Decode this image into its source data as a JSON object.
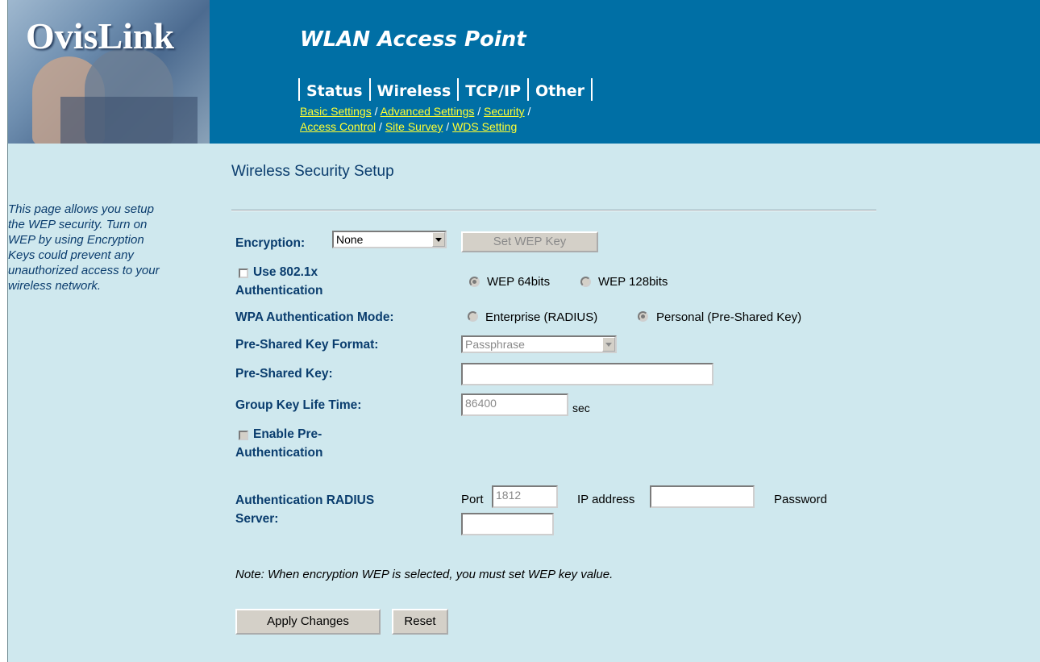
{
  "header": {
    "logo": "OvisLink",
    "title": "WLAN Access Point",
    "tabs": [
      "Status",
      "Wireless",
      "TCP/IP",
      "Other"
    ],
    "subnav_line1": [
      "Basic Settings",
      "Advanced Settings",
      "Security"
    ],
    "subnav_line2": [
      "Access Control",
      "Site Survey",
      "WDS Setting"
    ]
  },
  "sidebar": {
    "text": "This page allows you setup the WEP security. Turn on WEP by using Encryption Keys could prevent any unauthorized access to your wireless network."
  },
  "main": {
    "page_title": "Wireless Security Setup",
    "encryption_label": "Encryption:",
    "encryption_value": "None",
    "set_wep_key_button": "Set WEP Key",
    "use_8021x_label_1": "Use 802.1x",
    "use_8021x_label_2": "Authentication",
    "wep64_label": "WEP 64bits",
    "wep128_label": "WEP 128bits",
    "wpa_mode_label": "WPA Authentication Mode:",
    "enterprise_label": "Enterprise (RADIUS)",
    "personal_label": "Personal (Pre-Shared Key)",
    "psk_format_label": "Pre-Shared Key Format:",
    "psk_format_value": "Passphrase",
    "psk_label": "Pre-Shared Key:",
    "psk_value": "",
    "group_key_label": "Group Key Life Time:",
    "group_key_value": "86400",
    "group_key_unit": "sec",
    "preauth_label_1": "Enable Pre-",
    "preauth_label_2": "Authentication",
    "radius_label_1": "Authentication RADIUS",
    "radius_label_2": "Server:",
    "port_label": "Port",
    "port_value": "1812",
    "ip_label": "IP address",
    "ip_value": "",
    "password_label": "Password",
    "password_value": "",
    "note": "Note: When encryption WEP is selected, you must set WEP key value.",
    "apply_button": "Apply Changes",
    "reset_button": "Reset"
  }
}
